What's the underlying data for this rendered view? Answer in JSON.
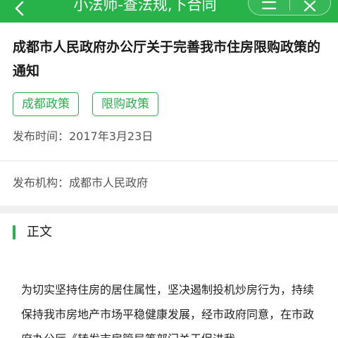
{
  "topbar": {
    "title": "小法师-查法规,下合同",
    "back_icon": "chevron-left-icon",
    "menu_icon": "more-icon",
    "close_icon": "close-icon",
    "background": "#27b24a"
  },
  "article": {
    "title": "成都市人民政府办公厅关于完善我市住房限购政策的通知",
    "tags": [
      "成都政策",
      "限购政策"
    ],
    "publish_date": "发布时间：2017年3月23日",
    "publisher": "发布机构：成都市人民政府"
  },
  "section": {
    "title": "正文",
    "accent": "#27b24a"
  },
  "content": {
    "paragraph": "为切实坚持住房的居住属性，坚决遏制投机炒房行为，持续保持我市房地产市场平稳健康发展，经市政府同意，在市政府办公厅《转发市房管局等部门关于促进我"
  }
}
